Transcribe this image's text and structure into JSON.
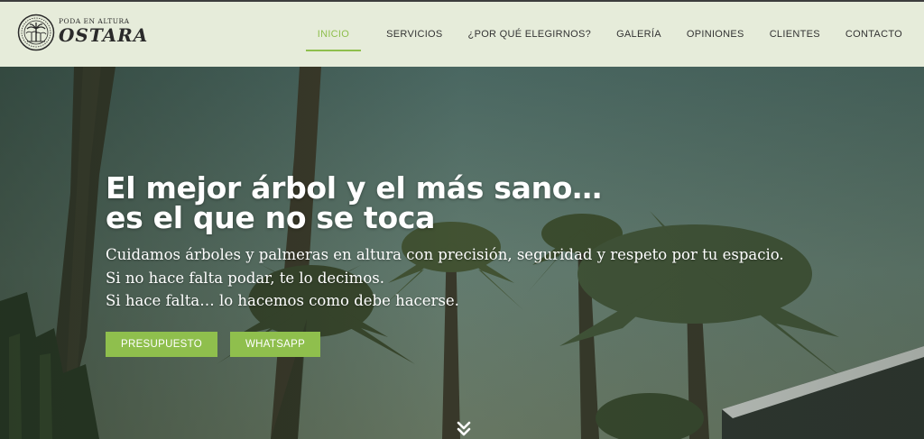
{
  "logo": {
    "line1": "PODA EN ALTURA",
    "line2": "OSTARA",
    "icon": "palm-seal-icon"
  },
  "nav": {
    "items": [
      {
        "label": "INICIO",
        "active": true
      },
      {
        "label": "SERVICIOS"
      },
      {
        "label": "¿POR QUÉ ELEGIRNOS?"
      },
      {
        "label": "GALERÍA"
      },
      {
        "label": "OPINIONES"
      },
      {
        "label": "CLIENTES"
      },
      {
        "label": "CONTACTO"
      }
    ]
  },
  "hero": {
    "title_line1": "El mejor árbol y el más sano…",
    "title_line2": "es el que no se toca",
    "sub_line1": "Cuidamos árboles y palmeras en altura con precisión, seguridad y respeto por tu espacio.",
    "sub_line2": "Si no hace falta podar, te lo decimos.",
    "sub_line3": "Si hace falta… lo hacemos como debe hacerse.",
    "button_quote": "PRESUPUESTO",
    "button_whatsapp": "WHATSAPP",
    "scroll_icon": "chevron-double-down-icon"
  },
  "colors": {
    "accent": "#8fbf4d",
    "header_bg": "#e6ecda",
    "nav_text": "#333333"
  }
}
